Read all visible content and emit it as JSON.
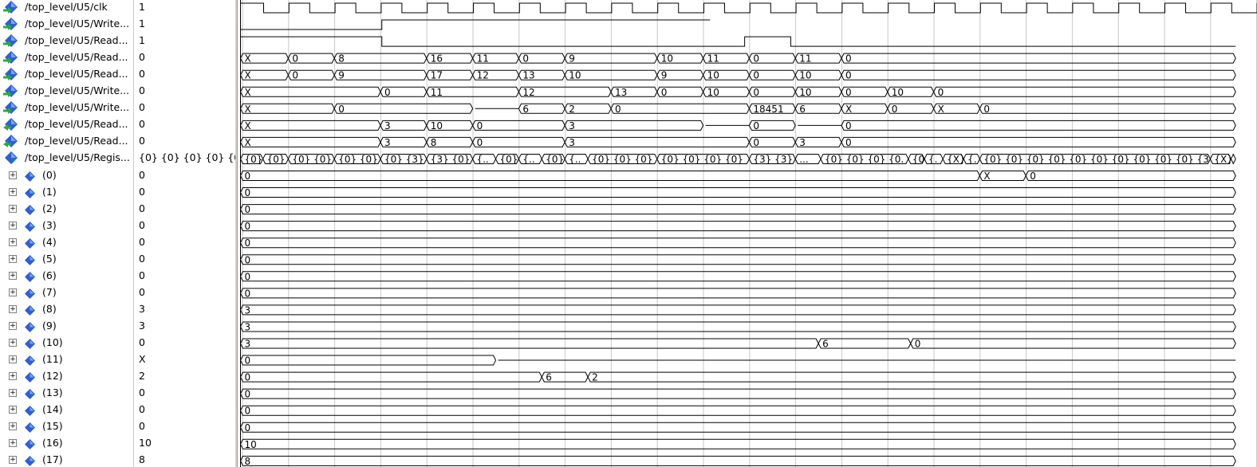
{
  "signals": [
    {
      "name": "/top_level/U5/clk",
      "value": "1",
      "icon": "signal-input-icon",
      "indent": 0
    },
    {
      "name": "/top_level/U5/Write...",
      "value": "1",
      "icon": "signal-input-icon",
      "indent": 0
    },
    {
      "name": "/top_level/U5/Read...",
      "value": "1",
      "icon": "signal-input-icon",
      "indent": 0
    },
    {
      "name": "/top_level/U5/Read...",
      "value": "0",
      "icon": "signal-input-icon",
      "indent": 0
    },
    {
      "name": "/top_level/U5/Read...",
      "value": "0",
      "icon": "signal-input-icon",
      "indent": 0
    },
    {
      "name": "/top_level/U5/Write...",
      "value": "0",
      "icon": "signal-input-icon",
      "indent": 0
    },
    {
      "name": "/top_level/U5/Write...",
      "value": "0",
      "icon": "signal-input-icon",
      "indent": 0
    },
    {
      "name": "/top_level/U5/Read...",
      "value": "0",
      "icon": "signal-output-icon",
      "indent": 0
    },
    {
      "name": "/top_level/U5/Read...",
      "value": "0",
      "icon": "signal-output-icon",
      "indent": 0
    },
    {
      "name": "/top_level/U5/Regis...",
      "value": "{0} {0} {0} {0} {0...",
      "icon": "signal-internal-icon",
      "indent": 0
    },
    {
      "name": "(0)",
      "value": "0",
      "icon": "array-element-icon",
      "indent": 1
    },
    {
      "name": "(1)",
      "value": "0",
      "icon": "array-element-icon",
      "indent": 1
    },
    {
      "name": "(2)",
      "value": "0",
      "icon": "array-element-icon",
      "indent": 1
    },
    {
      "name": "(3)",
      "value": "0",
      "icon": "array-element-icon",
      "indent": 1
    },
    {
      "name": "(4)",
      "value": "0",
      "icon": "array-element-icon",
      "indent": 1
    },
    {
      "name": "(5)",
      "value": "0",
      "icon": "array-element-icon",
      "indent": 1
    },
    {
      "name": "(6)",
      "value": "0",
      "icon": "array-element-icon",
      "indent": 1
    },
    {
      "name": "(7)",
      "value": "0",
      "icon": "array-element-icon",
      "indent": 1
    },
    {
      "name": "(8)",
      "value": "3",
      "icon": "array-element-icon",
      "indent": 1
    },
    {
      "name": "(9)",
      "value": "3",
      "icon": "array-element-icon",
      "indent": 1
    },
    {
      "name": "(10)",
      "value": "0",
      "icon": "array-element-icon",
      "indent": 1
    },
    {
      "name": "(11)",
      "value": "X",
      "icon": "array-element-icon",
      "indent": 1
    },
    {
      "name": "(12)",
      "value": "2",
      "icon": "array-element-icon",
      "indent": 1
    },
    {
      "name": "(13)",
      "value": "0",
      "icon": "array-element-icon",
      "indent": 1
    },
    {
      "name": "(14)",
      "value": "0",
      "icon": "array-element-icon",
      "indent": 1
    },
    {
      "name": "(15)",
      "value": "0",
      "icon": "array-element-icon",
      "indent": 1
    },
    {
      "name": "(16)",
      "value": "10",
      "icon": "array-element-icon",
      "indent": 1
    },
    {
      "name": "(17)",
      "value": "8",
      "icon": "array-element-icon",
      "indent": 1
    }
  ],
  "expand_glyph": "+",
  "colors": {
    "trace": "#000000",
    "grid": "#c8c8c8",
    "icon_blue": "#2f5fd0",
    "icon_green": "#2aa84a"
  },
  "waves": [
    {
      "type": "clock"
    },
    {
      "type": "bit",
      "segs": [
        [
          0,
          2.98,
          0
        ],
        [
          2.98,
          10.1,
          1
        ]
      ]
    },
    {
      "type": "bit",
      "segs": [
        [
          0,
          2.98,
          1
        ],
        [
          2.98,
          10.85,
          0
        ],
        [
          10.85,
          11.85,
          1
        ],
        [
          11.85,
          21.5,
          0
        ]
      ]
    },
    {
      "type": "bus",
      "segs": [
        [
          0.02,
          0.95,
          "X"
        ],
        [
          0.95,
          1.95,
          "0"
        ],
        [
          1.95,
          3.95,
          "8"
        ],
        [
          3.95,
          4.95,
          "16"
        ],
        [
          4.95,
          5.95,
          "11"
        ],
        [
          5.95,
          6.95,
          "0"
        ],
        [
          6.95,
          8.95,
          "9"
        ],
        [
          8.95,
          9.95,
          "10"
        ],
        [
          9.95,
          10.95,
          "11"
        ],
        [
          10.95,
          11.95,
          "0"
        ],
        [
          11.95,
          12.95,
          "11"
        ],
        [
          12.95,
          21.5,
          "0"
        ]
      ]
    },
    {
      "type": "bus",
      "segs": [
        [
          0.02,
          0.95,
          "X"
        ],
        [
          0.95,
          1.95,
          "0"
        ],
        [
          1.95,
          3.95,
          "9"
        ],
        [
          3.95,
          4.95,
          "17"
        ],
        [
          4.95,
          5.95,
          "12"
        ],
        [
          5.95,
          6.95,
          "13"
        ],
        [
          6.95,
          8.95,
          "10"
        ],
        [
          8.95,
          9.95,
          "9"
        ],
        [
          9.95,
          10.95,
          "10"
        ],
        [
          10.95,
          11.95,
          "0"
        ],
        [
          11.95,
          12.95,
          "10"
        ],
        [
          12.95,
          21.5,
          "0"
        ]
      ]
    },
    {
      "type": "bus",
      "segs": [
        [
          0.02,
          2.95,
          "X"
        ],
        [
          2.95,
          3.95,
          "0"
        ],
        [
          3.95,
          5.95,
          "11"
        ],
        [
          5.95,
          7.95,
          "12"
        ],
        [
          7.95,
          8.95,
          "13"
        ],
        [
          8.95,
          9.95,
          "0"
        ],
        [
          9.95,
          10.95,
          "10"
        ],
        [
          10.95,
          11.95,
          "0"
        ],
        [
          11.95,
          12.95,
          "10"
        ],
        [
          12.95,
          13.95,
          "0"
        ],
        [
          13.95,
          14.95,
          "10"
        ],
        [
          14.95,
          21.5,
          "0"
        ]
      ]
    },
    {
      "type": "bus",
      "segs": [
        [
          0.02,
          1.95,
          "X"
        ],
        [
          1.95,
          4.95,
          "0"
        ],
        [
          4.95,
          5.95,
          "Z"
        ],
        [
          5.95,
          6.95,
          "6"
        ],
        [
          6.95,
          7.95,
          "2"
        ],
        [
          7.95,
          10.95,
          "0"
        ],
        [
          10.95,
          11.95,
          "18451"
        ],
        [
          11.95,
          12.95,
          "6"
        ],
        [
          12.95,
          13.95,
          "X"
        ],
        [
          13.95,
          14.95,
          "0"
        ],
        [
          14.95,
          15.95,
          "X"
        ],
        [
          15.95,
          21.5,
          "0"
        ]
      ]
    },
    {
      "type": "bus",
      "segs": [
        [
          0.02,
          2.95,
          "X"
        ],
        [
          2.95,
          3.95,
          "3"
        ],
        [
          3.95,
          4.95,
          "10"
        ],
        [
          4.95,
          6.95,
          "0"
        ],
        [
          6.95,
          9.95,
          "3"
        ],
        [
          9.95,
          10.95,
          "Z"
        ],
        [
          10.95,
          11.95,
          "0"
        ],
        [
          11.95,
          12.95,
          "Z"
        ],
        [
          12.95,
          21.5,
          "0"
        ]
      ]
    },
    {
      "type": "bus",
      "segs": [
        [
          0.02,
          2.95,
          "X"
        ],
        [
          2.95,
          3.95,
          "3"
        ],
        [
          3.95,
          4.95,
          "8"
        ],
        [
          4.95,
          6.95,
          "0"
        ],
        [
          6.95,
          10.95,
          "3"
        ],
        [
          10.95,
          11.95,
          "0"
        ],
        [
          11.95,
          12.95,
          "3"
        ],
        [
          12.95,
          21.5,
          "0"
        ]
      ]
    },
    {
      "type": "bus",
      "segs": [
        [
          0.02,
          0.4,
          "{0}"
        ],
        [
          0.4,
          0.95,
          "{0}"
        ],
        [
          0.95,
          1.95,
          "{0} {0} {0}"
        ],
        [
          1.95,
          2.95,
          "{0} {0} {0}"
        ],
        [
          2.95,
          3.95,
          "{0} {3} {3}"
        ],
        [
          3.95,
          4.95,
          "{3} {0}"
        ],
        [
          4.95,
          5.45,
          "{..."
        ],
        [
          5.45,
          5.95,
          "{0}"
        ],
        [
          5.95,
          6.45,
          "{..."
        ],
        [
          6.45,
          6.95,
          "{0}"
        ],
        [
          6.95,
          7.45,
          "{..."
        ],
        [
          7.45,
          8.95,
          "{0} {0} {0} {0} {0}"
        ],
        [
          8.95,
          10.95,
          "{0} {0} {0} {0}"
        ],
        [
          10.95,
          11.95,
          "{3} {3} {3}"
        ],
        [
          11.95,
          12.5,
          "..."
        ],
        [
          12.5,
          14.4,
          "{0} {0} {0} {0..."
        ],
        [
          14.4,
          14.75,
          "{0}"
        ],
        [
          14.75,
          15.15,
          "{..."
        ],
        [
          15.15,
          15.6,
          "{X}"
        ],
        [
          15.6,
          15.95,
          "{..."
        ],
        [
          15.95,
          20.95,
          "{0} {0} {0} {0} {0} {0} {0} {0} {0} {0} {3} {3} {0}"
        ],
        [
          20.95,
          21.4,
          "{X}"
        ],
        [
          21.4,
          21.5,
          "{..."
        ]
      ]
    },
    {
      "type": "bus",
      "segs": [
        [
          0.02,
          15.95,
          "0"
        ],
        [
          15.95,
          16.95,
          "X"
        ],
        [
          16.95,
          21.5,
          "0"
        ]
      ]
    },
    {
      "type": "bus",
      "segs": [
        [
          0.02,
          21.5,
          "0"
        ]
      ]
    },
    {
      "type": "bus",
      "segs": [
        [
          0.02,
          21.5,
          "0"
        ]
      ]
    },
    {
      "type": "bus",
      "segs": [
        [
          0.02,
          21.5,
          "0"
        ]
      ]
    },
    {
      "type": "bus",
      "segs": [
        [
          0.02,
          21.5,
          "0"
        ]
      ]
    },
    {
      "type": "bus",
      "segs": [
        [
          0.02,
          21.5,
          "0"
        ]
      ]
    },
    {
      "type": "bus",
      "segs": [
        [
          0.02,
          21.5,
          "0"
        ]
      ]
    },
    {
      "type": "bus",
      "segs": [
        [
          0.02,
          21.5,
          "0"
        ]
      ]
    },
    {
      "type": "bus",
      "segs": [
        [
          0.02,
          21.5,
          "3"
        ]
      ]
    },
    {
      "type": "bus",
      "segs": [
        [
          0.02,
          21.5,
          "3"
        ]
      ]
    },
    {
      "type": "bus",
      "segs": [
        [
          0.02,
          12.45,
          "3"
        ],
        [
          12.45,
          14.45,
          "6"
        ],
        [
          14.45,
          21.5,
          "0"
        ]
      ]
    },
    {
      "type": "bus",
      "segs": [
        [
          0.02,
          5.45,
          "0"
        ],
        [
          5.45,
          21.5,
          "Z"
        ]
      ]
    },
    {
      "type": "bus",
      "segs": [
        [
          0.02,
          6.45,
          "0"
        ],
        [
          6.45,
          7.45,
          "6"
        ],
        [
          7.45,
          21.5,
          "2"
        ]
      ]
    },
    {
      "type": "bus",
      "segs": [
        [
          0.02,
          21.5,
          "0"
        ]
      ]
    },
    {
      "type": "bus",
      "segs": [
        [
          0.02,
          21.5,
          "0"
        ]
      ]
    },
    {
      "type": "bus",
      "segs": [
        [
          0.02,
          21.5,
          "0"
        ]
      ]
    },
    {
      "type": "bus",
      "segs": [
        [
          0.02,
          21.5,
          "10"
        ]
      ]
    },
    {
      "type": "bus",
      "segs": [
        [
          0.02,
          21.5,
          "8"
        ]
      ]
    }
  ]
}
